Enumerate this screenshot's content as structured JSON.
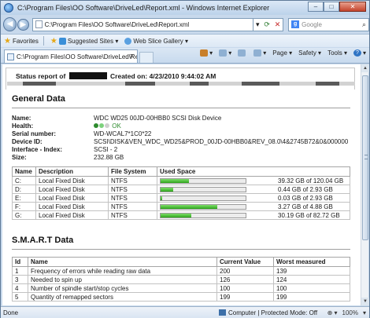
{
  "window": {
    "title": "C:\\Program Files\\OO Software\\DriveLed\\Report.xml - Windows Internet Explorer",
    "min": "–",
    "max": "□",
    "close": "✕"
  },
  "address": {
    "url": "C:\\Program Files\\OO Software\\DriveLed\\Report.xml",
    "search_placeholder": "Google"
  },
  "favorites": {
    "label": "Favorites",
    "items": [
      "Suggested Sites ▾",
      "Web Slice Gallery ▾"
    ]
  },
  "tab": {
    "label": "C:\\Program Files\\OO Software\\DriveLed\\Report.x..."
  },
  "commands": [
    "▾",
    "▾",
    "▾",
    "Page ▾",
    "Safety ▾",
    "Tools ▾",
    "▾"
  ],
  "report": {
    "status_prefix": "Status report of",
    "status_suffix": "Created on: 4/23/2010 9:44:02 AM",
    "general_heading": "General Data",
    "fields": [
      {
        "key": "Name:",
        "value": "WDC WD25 00JD-00HBB0 SCSI Disk Device"
      },
      {
        "key": "Health:",
        "value": "OK"
      },
      {
        "key": "Serial number:",
        "value": "WD-WCAL7*1C0*22"
      },
      {
        "key": "Device ID:",
        "value": "SCSI\\DISK&VEN_WDC_WD25&PROD_00JD-00HBB0&REV_08.0\\4&2745B72&0&000000"
      },
      {
        "key": "Interface - Index:",
        "value": "SCSI - 2"
      },
      {
        "key": "Size:",
        "value": "232.88 GB"
      }
    ],
    "health_colors": [
      "#2e8b2e",
      "#7dd17d",
      "#cfcfcf"
    ],
    "drive_headers": [
      "Name",
      "Description",
      "File System",
      "Used Space"
    ],
    "drives": [
      {
        "name": "C:",
        "desc": "Local Fixed Disk",
        "fs": "NTFS",
        "used": "39.32 GB of 120.04 GB",
        "pct": 0.33
      },
      {
        "name": "D:",
        "desc": "Local Fixed Disk",
        "fs": "NTFS",
        "used": "0.44 GB of 2.93 GB",
        "pct": 0.15
      },
      {
        "name": "E:",
        "desc": "Local Fixed Disk",
        "fs": "NTFS",
        "used": "0.03 GB of 2.93 GB",
        "pct": 0.02
      },
      {
        "name": "F:",
        "desc": "Local Fixed Disk",
        "fs": "NTFS",
        "used": "3.27 GB of 4.88 GB",
        "pct": 0.67
      },
      {
        "name": "G:",
        "desc": "Local Fixed Disk",
        "fs": "NTFS",
        "used": "30.19 GB of 82.72 GB",
        "pct": 0.36
      }
    ],
    "smart_heading": "S.M.A.R.T Data",
    "smart_headers": [
      "Id",
      "Name",
      "Current Value",
      "Worst measured"
    ],
    "smart": [
      {
        "id": "1",
        "name": "Frequency of errors while reading raw data",
        "current": "200",
        "worst": "139"
      },
      {
        "id": "3",
        "name": "Needed to spin up",
        "current": "126",
        "worst": "124"
      },
      {
        "id": "4",
        "name": "Number of spindle start/stop cycles",
        "current": "100",
        "worst": "100"
      },
      {
        "id": "5",
        "name": "Quantity of remapped sectors",
        "current": "199",
        "worst": "199"
      }
    ]
  },
  "statusbar": {
    "left": "Done",
    "zone": "Computer | Protected Mode: Off",
    "zoom": "100%"
  }
}
